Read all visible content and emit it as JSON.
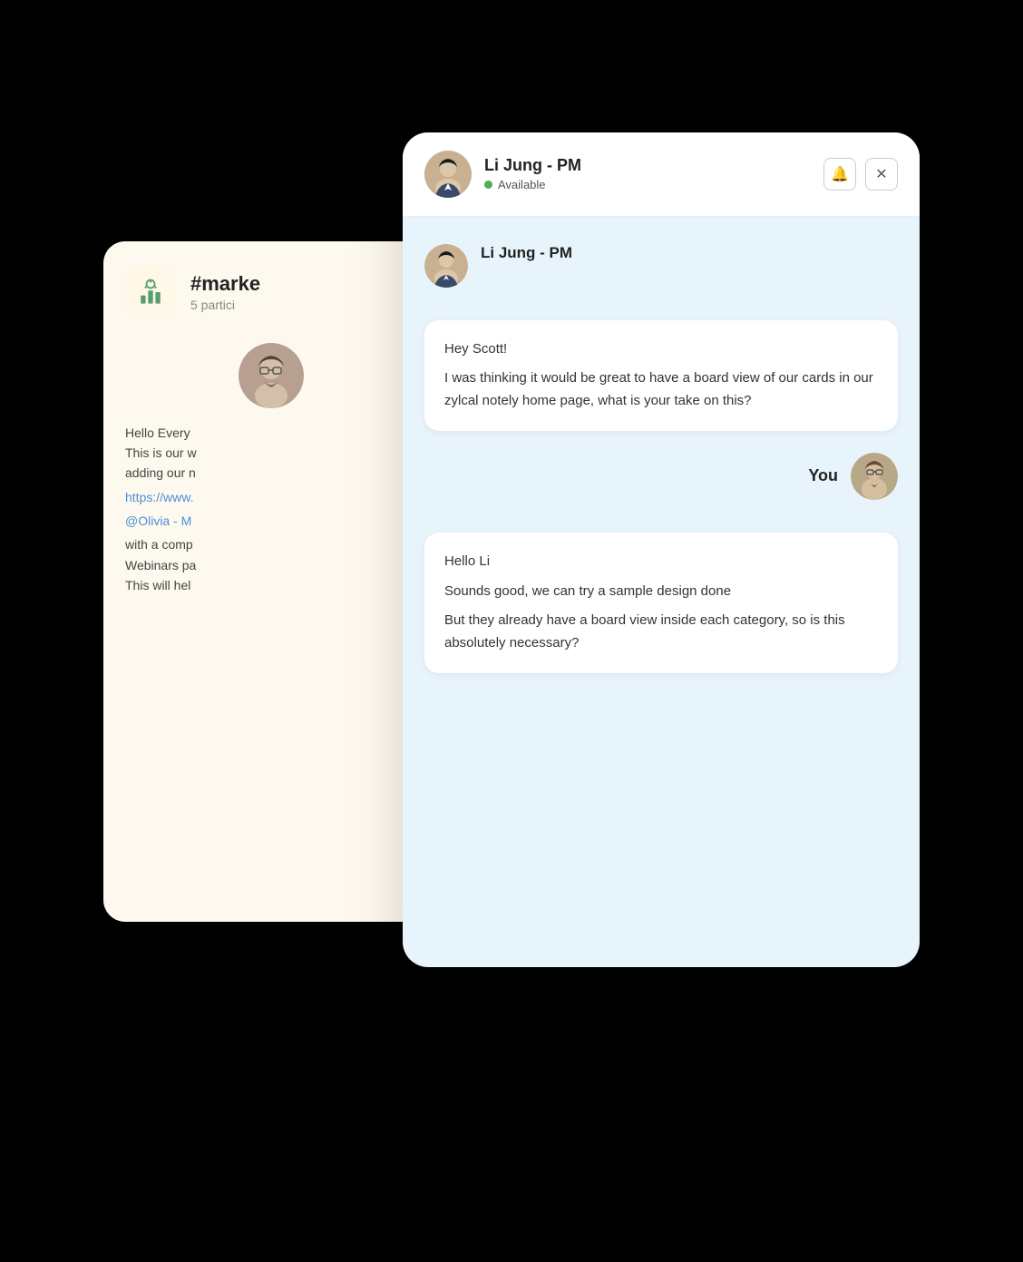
{
  "channel": {
    "icon_label": "chart-icon",
    "name": "#marke",
    "participants": "5 partici",
    "avatar_label": "channel-user-avatar",
    "body_lines": [
      "Hello Every",
      "This is our w",
      "adding our n"
    ],
    "link": "https://www.",
    "mention": "@Olivia - M",
    "body_lines2": [
      "with a comp",
      "Webinars pa",
      "This will hel"
    ]
  },
  "dm": {
    "header": {
      "user_name": "Li Jung - PM",
      "status": "Available",
      "bell_icon": "🔔",
      "close_icon": "✕"
    },
    "messages": [
      {
        "sender": "Li Jung - PM",
        "lines": [
          "Hey Scott!",
          "I was thinking it would be great to have a board view of our cards in our zylcal notely home page, what is your take on this?"
        ]
      }
    ],
    "you_label": "You",
    "reply": {
      "lines": [
        "Hello Li",
        "Sounds good, we can try a sample design done",
        "But they already have a board view inside each category, so is this absolutely necessary?"
      ]
    }
  }
}
